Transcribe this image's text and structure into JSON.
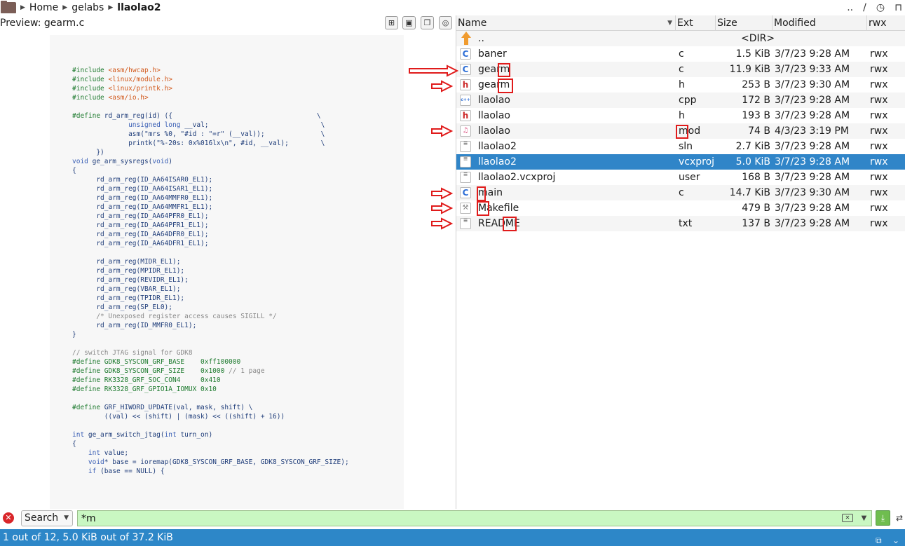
{
  "breadcrumb": {
    "items": [
      "Home",
      "gelabs",
      "llaolao2"
    ]
  },
  "toolbar_right": {
    "parent": "..",
    "root": "/"
  },
  "preview": {
    "title": "Preview: gearm.c",
    "code_lines": [
      "#include <asm/hwcap.h>",
      "#include <linux/module.h>",
      "#include <linux/printk.h>",
      "#include <asm/io.h>",
      "",
      "#define rd_arm_reg(id) ({                                    \\",
      "              unsigned long __val;                            \\",
      "              asm(\"mrs %0, \"#id : \"=r\" (__val));              \\",
      "              printk(\"%-20s: 0x%016lx\\n\", #id, __val);        \\",
      "      })",
      "void ge_arm_sysregs(void)",
      "{",
      "      rd_arm_reg(ID_AA64ISAR0_EL1);",
      "      rd_arm_reg(ID_AA64ISAR1_EL1);",
      "      rd_arm_reg(ID_AA64MMFR0_EL1);",
      "      rd_arm_reg(ID_AA64MMFR1_EL1);",
      "      rd_arm_reg(ID_AA64PFR0_EL1);",
      "      rd_arm_reg(ID_AA64PFR1_EL1);",
      "      rd_arm_reg(ID_AA64DFR0_EL1);",
      "      rd_arm_reg(ID_AA64DFR1_EL1);",
      "",
      "      rd_arm_reg(MIDR_EL1);",
      "      rd_arm_reg(MPIDR_EL1);",
      "      rd_arm_reg(REVIDR_EL1);",
      "      rd_arm_reg(VBAR_EL1);",
      "      rd_arm_reg(TPIDR_EL1);",
      "      rd_arm_reg(SP_EL0);",
      "      /* Unexposed register access causes SIGILL */",
      "      rd_arm_reg(ID_MMFR0_EL1);",
      "}",
      "",
      "// switch JTAG signal for GDK8",
      "#define GDK8_SYSCON_GRF_BASE    0xff100000",
      "#define GDK8_SYSCON_GRF_SIZE    0x1000 // 1 page",
      "#define RK3328_GRF_SOC_CON4     0x410",
      "#define RK3328_GRF_GPIO1A_IOMUX 0x10",
      "",
      "#define GRF_HIWORD_UPDATE(val, mask, shift) \\",
      "        ((val) << (shift) | (mask) << ((shift) + 16))",
      "",
      "int ge_arm_switch_jtag(int turn_on)",
      "{",
      "    int value;",
      "    void* base = ioremap(GDK8_SYSCON_GRF_BASE, GDK8_SYSCON_GRF_SIZE);",
      "    if (base == NULL) {"
    ]
  },
  "filelist": {
    "columns": [
      "Name",
      "Ext",
      "Size",
      "Modified",
      "rwx"
    ],
    "rows": [
      {
        "icon": "up-arrow-icon",
        "name": "..",
        "ext": "",
        "size": "<DIR>",
        "modified": "",
        "attr": "",
        "is_dir": true
      },
      {
        "icon": "c-file-icon",
        "name": "baner",
        "ext": "c",
        "size": "1.5 KiB",
        "modified": "3/7/23 9:28 AM",
        "attr": "rwx"
      },
      {
        "icon": "c-file-icon",
        "name": "gearm",
        "ext": "c",
        "size": "11.9 KiB",
        "modified": "3/7/23 9:33 AM",
        "attr": "rwx"
      },
      {
        "icon": "h-file-icon",
        "name": "gearm",
        "ext": "h",
        "size": "253 B",
        "modified": "3/7/23 9:30 AM",
        "attr": "rwx"
      },
      {
        "icon": "cpp-file-icon",
        "name": "llaolao",
        "ext": "cpp",
        "size": "172 B",
        "modified": "3/7/23 9:28 AM",
        "attr": "rwx"
      },
      {
        "icon": "h-file-icon",
        "name": "llaolao",
        "ext": "h",
        "size": "193 B",
        "modified": "3/7/23 9:28 AM",
        "attr": "rwx"
      },
      {
        "icon": "music-file-icon",
        "name": "llaolao",
        "ext": "mod",
        "size": "74 B",
        "modified": "4/3/23 3:19 PM",
        "attr": "rwx"
      },
      {
        "icon": "text-file-icon",
        "name": "llaolao2",
        "ext": "sln",
        "size": "2.7 KiB",
        "modified": "3/7/23 9:28 AM",
        "attr": "rwx"
      },
      {
        "icon": "text-file-icon",
        "name": "llaolao2",
        "ext": "vcxproj",
        "size": "5.0 KiB",
        "modified": "3/7/23 9:28 AM",
        "attr": "rwx",
        "selected": true
      },
      {
        "icon": "text-file-icon",
        "name": "llaolao2.vcxproj",
        "ext": "user",
        "size": "168 B",
        "modified": "3/7/23 9:28 AM",
        "attr": "rwx"
      },
      {
        "icon": "c-file-icon",
        "name": "main",
        "ext": "c",
        "size": "14.7 KiB",
        "modified": "3/7/23 9:30 AM",
        "attr": "rwx"
      },
      {
        "icon": "makefile-icon",
        "name": "Makefile",
        "ext": "",
        "size": "479 B",
        "modified": "3/7/23 9:28 AM",
        "attr": "rwx"
      },
      {
        "icon": "text-file-icon",
        "name": "README",
        "ext": "txt",
        "size": "137 B",
        "modified": "3/7/23 9:28 AM",
        "attr": "rwx"
      }
    ]
  },
  "search": {
    "mode": "Search",
    "query": "*m"
  },
  "status": {
    "text": "1 out of 12, 5.0 KiB out of 37.2 KiB"
  },
  "colors": {
    "selection": "#3085c8",
    "statusbar": "#2d87c8",
    "search_bg": "#c9f7c2",
    "annotation": "#e01b1b"
  }
}
